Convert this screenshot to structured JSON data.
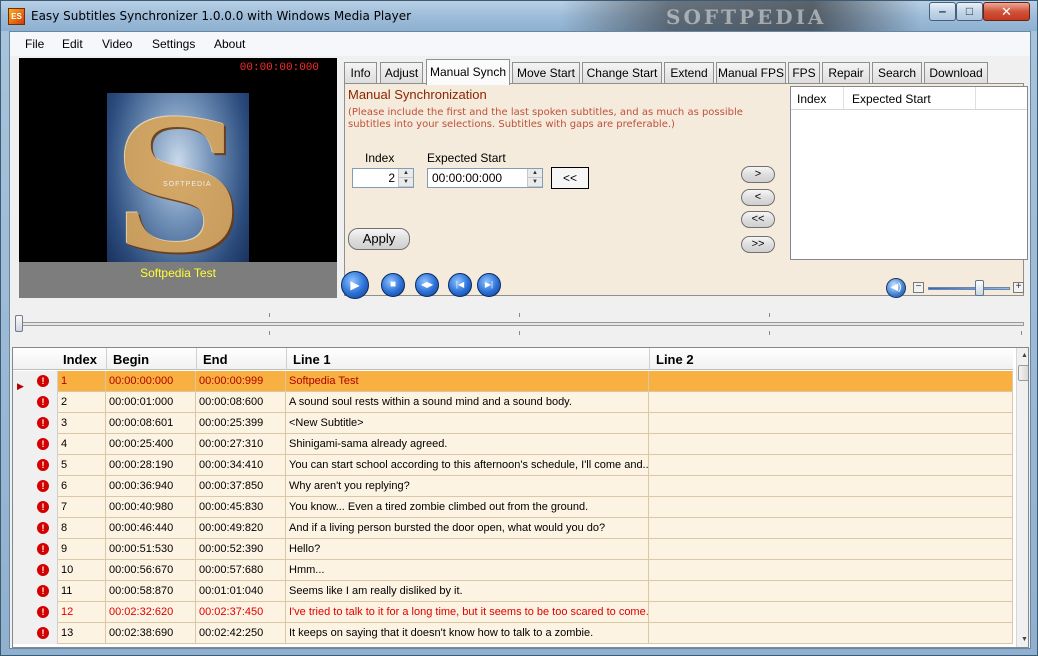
{
  "window": {
    "title": "Easy Subtitles Synchronizer 1.0.0.0 with Windows Media Player",
    "icon_text": "ES",
    "watermark": "SOFTPEDIA",
    "min_glyph": "‒",
    "max_glyph": "□",
    "close_glyph": "✕"
  },
  "menu": [
    "File",
    "Edit",
    "Video",
    "Settings",
    "About"
  ],
  "video": {
    "time": "00:00:00:000",
    "poster_letter": "S",
    "poster_label": "SOFTPEDIA",
    "caption": "Softpedia Test"
  },
  "tabs": [
    "Info",
    "Adjust",
    "Manual Synch",
    "Move Start",
    "Change Start",
    "Extend",
    "Manual FPS",
    "FPS",
    "Repair",
    "Search",
    "Download"
  ],
  "active_tab": "Manual Synch",
  "panel": {
    "title": "Manual Synchronization",
    "note": "(Please include the first and the last spoken subtitles, and as much as possible subtitles into your selections. Subtitles with gaps are preferable.)",
    "index_label": "Index",
    "index_value": "2",
    "expected_label": "Expected Start",
    "expected_value": "00:00:00:000",
    "copy_button": "<<",
    "apply_button": "Apply",
    "side_buttons": [
      ">",
      "<",
      "<<",
      ">>"
    ],
    "list_columns": [
      "Index",
      "Expected Start"
    ]
  },
  "player": {
    "play_glyph": "▶",
    "stop_glyph": "■",
    "frame_glyph": "◀▶",
    "prev_glyph": "|◀",
    "next_glyph": "▶|",
    "volume_glyph": "◀)",
    "vol_minus": "−",
    "vol_plus": "+",
    "volume_level": 0.6,
    "seek_position": 0.0
  },
  "grid": {
    "columns": [
      "Index",
      "Begin",
      "End",
      "Line 1",
      "Line 2"
    ],
    "rows": [
      {
        "index": "1",
        "begin": "00:00:00:000",
        "end": "00:00:00:999",
        "line1": "Softpedia Test",
        "line2": ""
      },
      {
        "index": "2",
        "begin": "00:00:01:000",
        "end": "00:00:08:600",
        "line1": "A sound soul rests within a sound mind and a sound body.",
        "line2": ""
      },
      {
        "index": "3",
        "begin": "00:00:08:601",
        "end": "00:00:25:399",
        "line1": "<New Subtitle>",
        "line2": ""
      },
      {
        "index": "4",
        "begin": "00:00:25:400",
        "end": "00:00:27:310",
        "line1": "Shinigami-sama already agreed.",
        "line2": ""
      },
      {
        "index": "5",
        "begin": "00:00:28:190",
        "end": "00:00:34:410",
        "line1": "You can start school according to this afternoon's schedule, I'll come and...",
        "line2": ""
      },
      {
        "index": "6",
        "begin": "00:00:36:940",
        "end": "00:00:37:850",
        "line1": "Why aren't you replying?",
        "line2": ""
      },
      {
        "index": "7",
        "begin": "00:00:40:980",
        "end": "00:00:45:830",
        "line1": "You know... Even a tired zombie climbed out from the ground.",
        "line2": ""
      },
      {
        "index": "8",
        "begin": "00:00:46:440",
        "end": "00:00:49:820",
        "line1": "And if a living person bursted the door open, what would you do?",
        "line2": ""
      },
      {
        "index": "9",
        "begin": "00:00:51:530",
        "end": "00:00:52:390",
        "line1": "Hello?",
        "line2": ""
      },
      {
        "index": "10",
        "begin": "00:00:56:670",
        "end": "00:00:57:680",
        "line1": "Hmm...",
        "line2": ""
      },
      {
        "index": "11",
        "begin": "00:00:58:870",
        "end": "00:01:01:040",
        "line1": "Seems like I am really disliked by it.",
        "line2": ""
      },
      {
        "index": "12",
        "begin": "00:02:32:620",
        "end": "00:02:37:450",
        "line1": "I've tried to talk to it for a long time, but it seems to be too scared to come...",
        "line2": ""
      },
      {
        "index": "13",
        "begin": "00:02:38:690",
        "end": "00:02:42:250",
        "line1": "It keeps on saying that it doesn't know how to talk to a zombie.",
        "line2": ""
      }
    ],
    "selected_index": 0,
    "red_rows": [
      11
    ],
    "error_glyph": "!",
    "row_pointer": "▶",
    "scroll_up": "▲",
    "scroll_down": "▼"
  }
}
